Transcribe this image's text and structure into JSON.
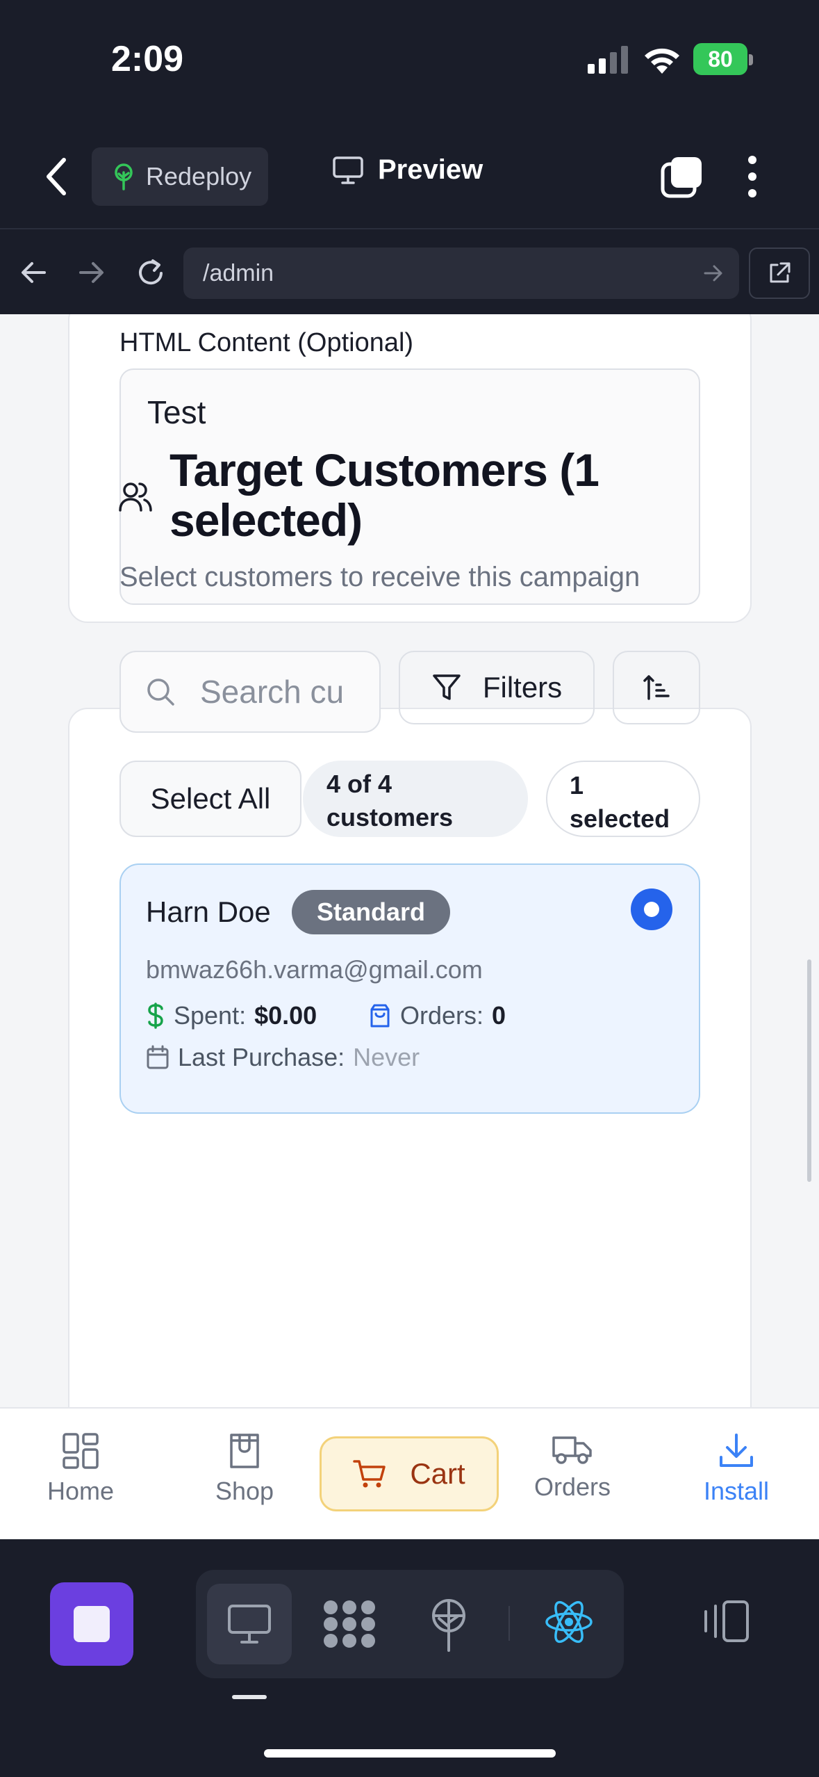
{
  "status_bar": {
    "time": "2:09",
    "battery": "80"
  },
  "editor_header": {
    "redeploy_label": "Redeploy",
    "preview_label": "Preview"
  },
  "url_bar": {
    "path": "/admin"
  },
  "html_content": {
    "label": "HTML Content (Optional)",
    "value": "Test"
  },
  "target_customers": {
    "title": "Target Customers (1 selected)",
    "subtitle": "Select customers to receive this campaign",
    "search_placeholder": "Search cu",
    "filters_label": "Filters",
    "select_all_label": "Select All",
    "count_label": "4 of 4 customers",
    "selected_label": "1 selected",
    "customers": [
      {
        "name": "Harn Doe",
        "tier": "Standard",
        "email": "bmwaz66h.varma@gmail.com",
        "spent_label": "Spent:",
        "spent_value": "$0.00",
        "orders_label": "Orders:",
        "orders_value": "0",
        "last_purchase_label": "Last Purchase:",
        "last_purchase_value": "Never",
        "selected": true
      }
    ]
  },
  "app_nav": {
    "home": "Home",
    "shop": "Shop",
    "cart": "Cart",
    "orders": "Orders",
    "install": "Install"
  },
  "colors": {
    "accent_blue": "#2563eb",
    "install_blue": "#3b82f6",
    "cart_brown": "#9a3412",
    "stop_purple": "#6b3fe0",
    "dark_bg": "#1a1d29"
  }
}
